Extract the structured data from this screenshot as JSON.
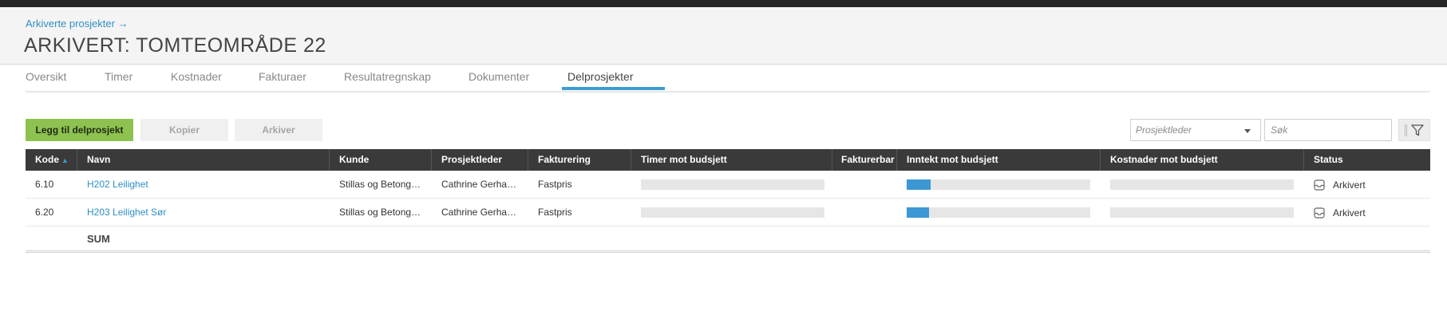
{
  "header": {
    "breadcrumb": "Arkiverte prosjekter →",
    "title": "ARKIVERT: TOMTEOMRÅDE 22"
  },
  "tabs": [
    {
      "label": "Oversikt"
    },
    {
      "label": "Timer"
    },
    {
      "label": "Kostnader"
    },
    {
      "label": "Fakturaer"
    },
    {
      "label": "Resultatregnskap"
    },
    {
      "label": "Dokumenter"
    },
    {
      "label": "Delprosjekter",
      "active": true
    }
  ],
  "toolbar": {
    "add_label": "Legg til delprosjekt",
    "copy_label": "Kopier",
    "archive_label": "Arkiver",
    "project_lead_placeholder": "Prosjektleder",
    "search_placeholder": "Søk"
  },
  "table": {
    "columns": {
      "kode": "Kode",
      "navn": "Navn",
      "kunde": "Kunde",
      "prosjektleder": "Prosjektleder",
      "fakturering": "Fakturering",
      "timer": "Timer mot budsjett",
      "fakturerbar": "Fakturerbar",
      "inntekt": "Inntekt mot budsjett",
      "kostnader": "Kostnader mot budsjett",
      "status": "Status"
    },
    "sort_indicator": "▲",
    "rows": [
      {
        "kode": "6.10",
        "navn": "H202 Leilighet",
        "kunde": "Stillas og Betong…",
        "prosjektleder": "Cathrine Gerha…",
        "fakturering": "Fastpris",
        "timer_progress": 0,
        "inntekt_progress": 0.13,
        "kostnader_progress": 0,
        "status": "Arkivert"
      },
      {
        "kode": "6.20",
        "navn": "H203 Leilighet Sør",
        "kunde": "Stillas og Betong…",
        "prosjektleder": "Cathrine Gerha…",
        "fakturering": "Fastpris",
        "timer_progress": 0,
        "inntekt_progress": 0.12,
        "kostnader_progress": 0,
        "status": "Arkivert"
      }
    ],
    "sum_label": "SUM"
  },
  "colors": {
    "accent": "#3c9bd3",
    "primary_button": "#8dc150",
    "header_row": "#3a3a3a",
    "link": "#2f8fc4"
  },
  "icons": {
    "filter": "filter-icon",
    "archive": "archive-box-icon",
    "sort": "sort-ascending-icon",
    "dropdown": "chevron-down-icon"
  }
}
